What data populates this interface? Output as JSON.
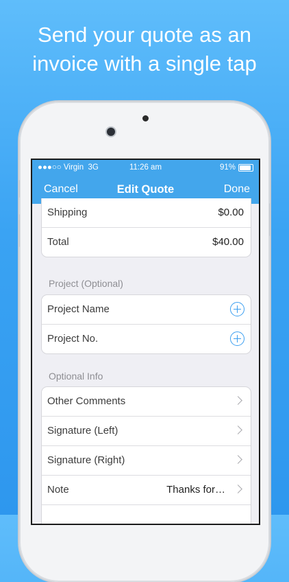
{
  "headline": {
    "line1": "Send your quote as an",
    "line2": "invoice with a single tap"
  },
  "status_bar": {
    "carrier": "●●●○○ Virgin",
    "network": "3G",
    "time": "11:26 am",
    "battery": "91%"
  },
  "nav": {
    "left": "Cancel",
    "title": "Edit Quote",
    "right": "Done"
  },
  "totals": [
    {
      "label": "Shipping",
      "value": "$0.00"
    },
    {
      "label": "Total",
      "value": "$40.00"
    }
  ],
  "project": {
    "header": "Project (Optional)",
    "rows": [
      {
        "label": "Project Name",
        "icon": "add-circle-icon"
      },
      {
        "label": "Project No.",
        "icon": "add-circle-icon"
      }
    ]
  },
  "optional_info": {
    "header": "Optional Info",
    "rows": [
      {
        "label": "Other Comments",
        "icon": "chevron-right-icon"
      },
      {
        "label": "Signature (Left)",
        "icon": "chevron-right-icon"
      },
      {
        "label": "Signature (Right)",
        "icon": "chevron-right-icon"
      },
      {
        "label": "Note",
        "value": "Thanks for…",
        "icon": "chevron-right-icon"
      }
    ]
  },
  "colors": {
    "background": "#3aa3f3",
    "nav_bar": "#43a6ec",
    "accent": "#3a9ef0"
  }
}
